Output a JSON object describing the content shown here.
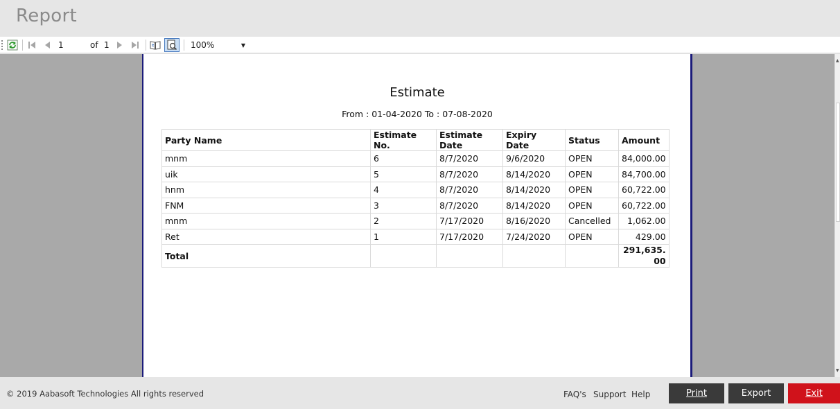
{
  "window": {
    "title": "Report"
  },
  "toolbar": {
    "page_current": "1",
    "of_label": "of",
    "page_total": "1",
    "zoom": "100%",
    "icons": [
      "refresh-icon",
      "first-page-icon",
      "prev-page-icon",
      "next-page-icon",
      "last-page-icon",
      "print-layout-icon",
      "page-setup-icon",
      "dropdown-arrow-icon"
    ]
  },
  "report": {
    "title": "Estimate",
    "subtitle": "From : 01-04-2020 To : 07-08-2020",
    "columns": [
      "Party Name",
      "Estimate No.",
      "Estimate Date",
      "Expiry Date",
      "Status",
      "Amount"
    ],
    "rows": [
      [
        "mnm",
        "6",
        "8/7/2020",
        "9/6/2020",
        "OPEN",
        "84,000.00"
      ],
      [
        "uik",
        "5",
        "8/7/2020",
        "8/14/2020",
        "OPEN",
        "84,700.00"
      ],
      [
        "hnm",
        "4",
        "8/7/2020",
        "8/14/2020",
        "OPEN",
        "60,722.00"
      ],
      [
        "FNM",
        "3",
        "8/7/2020",
        "8/14/2020",
        "OPEN",
        "60,722.00"
      ],
      [
        "mnm",
        "2",
        "7/17/2020",
        "8/16/2020",
        "Cancelled",
        "1,062.00"
      ],
      [
        "Ret",
        "1",
        "7/17/2020",
        "7/24/2020",
        "OPEN",
        "429.00"
      ]
    ],
    "total_label": "Total",
    "total_amount": "291,635.00"
  },
  "footer": {
    "copyright": "© 2019 Aabasoft Technologies All rights reserved",
    "links": [
      "FAQ's",
      "Support",
      "Help"
    ],
    "buttons": {
      "print": "Print",
      "export": "Export",
      "exit": "Exit"
    }
  },
  "colors": {
    "exit_button": "#d0121b",
    "dark_button": "#3a3a3a",
    "page_border": "#1b1b7a",
    "viewer_bg": "#a9a9a9"
  }
}
